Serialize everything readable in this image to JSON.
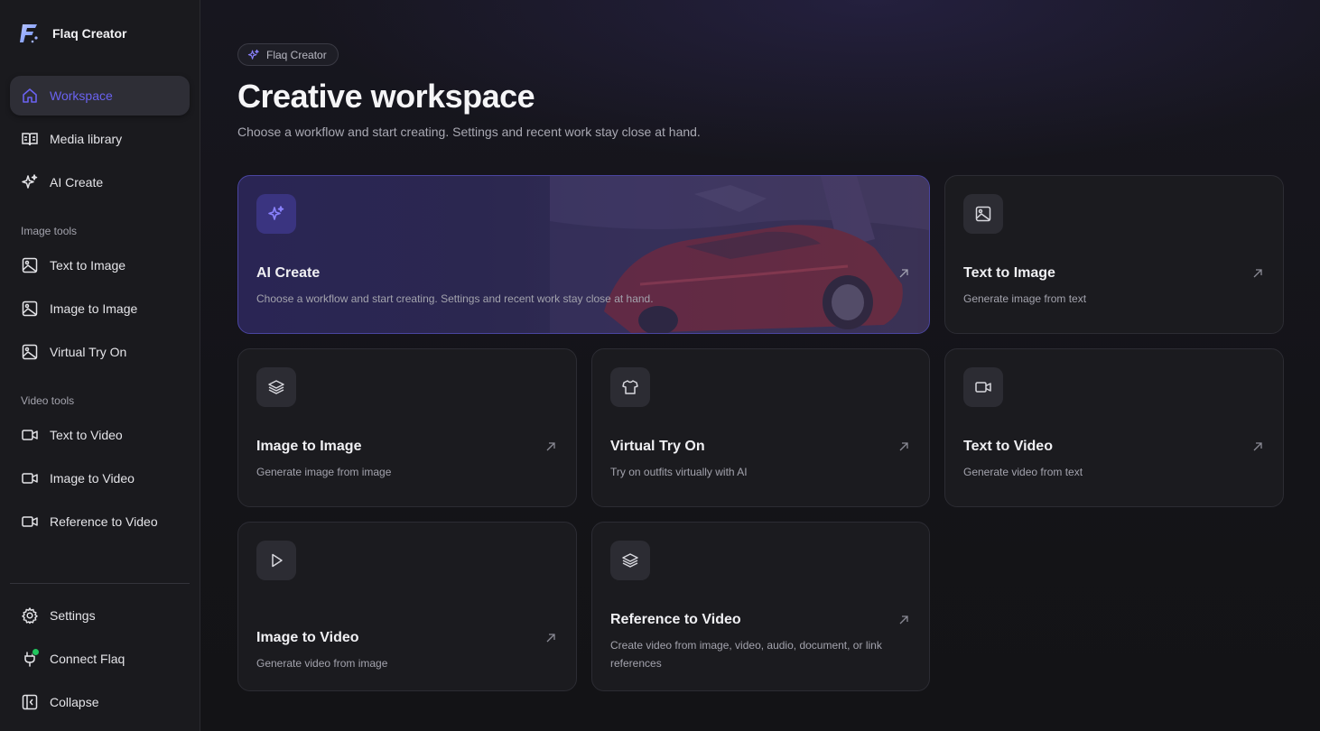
{
  "app": {
    "name": "Flaq Creator"
  },
  "sidebar": {
    "nav": [
      {
        "label": "Workspace",
        "icon": "home-icon",
        "active": true
      },
      {
        "label": "Media library",
        "icon": "book-icon"
      },
      {
        "label": "AI Create",
        "icon": "sparkles-icon"
      }
    ],
    "image_tools_label": "Image tools",
    "image_tools": [
      {
        "label": "Text to Image",
        "icon": "image-icon"
      },
      {
        "label": "Image to Image",
        "icon": "image-icon"
      },
      {
        "label": "Virtual Try On",
        "icon": "image-icon"
      }
    ],
    "video_tools_label": "Video tools",
    "video_tools": [
      {
        "label": "Text to Video",
        "icon": "video-icon"
      },
      {
        "label": "Image to Video",
        "icon": "video-icon"
      },
      {
        "label": "Reference to Video",
        "icon": "video-icon"
      }
    ],
    "footer": [
      {
        "label": "Settings",
        "icon": "gear-icon"
      },
      {
        "label": "Connect Flaq",
        "icon": "plug-icon",
        "status_color": "#22c55e"
      },
      {
        "label": "Collapse",
        "icon": "collapse-icon"
      }
    ]
  },
  "header": {
    "badge": "Flaq Creator",
    "title": "Creative workspace",
    "subtitle": "Choose a workflow and start creating. Settings and recent work stay close at hand."
  },
  "cards": [
    {
      "title": "AI Create",
      "desc": "Choose a workflow and start creating. Settings and recent work stay close at hand.",
      "icon": "sparkles-icon",
      "featured": true
    },
    {
      "title": "Text to Image",
      "desc": "Generate image from text",
      "icon": "image-icon"
    },
    {
      "title": "Image to Image",
      "desc": "Generate image from image",
      "icon": "layers-icon"
    },
    {
      "title": "Virtual Try On",
      "desc": "Try on outfits virtually with AI",
      "icon": "shirt-icon"
    },
    {
      "title": "Text to Video",
      "desc": "Generate video from text",
      "icon": "video-icon"
    },
    {
      "title": "Image to Video",
      "desc": "Generate video from image",
      "icon": "play-icon"
    },
    {
      "title": "Reference to Video",
      "desc": "Create video from image, video, audio, document, or link references",
      "icon": "layers-icon"
    }
  ],
  "colors": {
    "accent": "#6a62f0",
    "status_online": "#22c55e"
  }
}
